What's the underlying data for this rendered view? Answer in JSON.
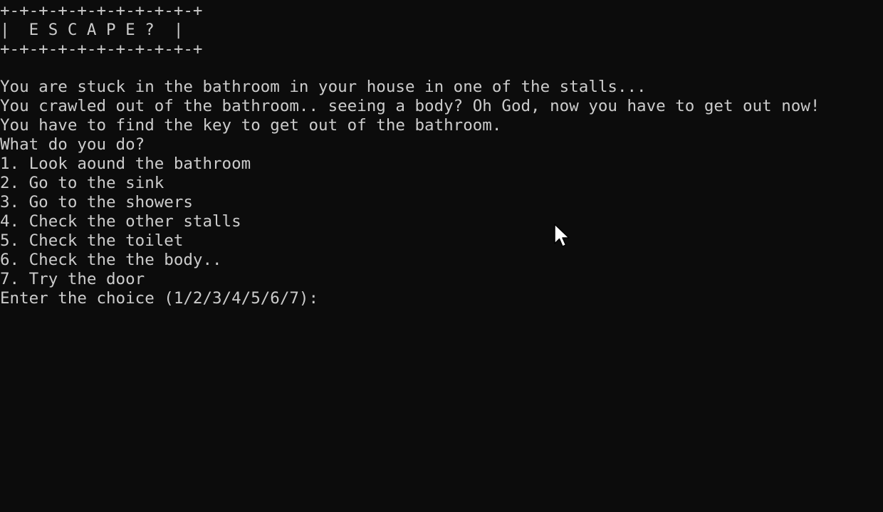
{
  "terminal": {
    "banner": {
      "border_top": "+-+-+-+-+-+-+-+-+-+-+",
      "title": "|  E S C A P E ?  |",
      "border_bottom": "+-+-+-+-+-+-+-+-+-+-+"
    },
    "story": [
      "You are stuck in the bathroom in your house in one of the stalls...",
      "You crawled out of the bathroom.. seeing a body? Oh God, now you have to get out now!",
      "You have to find the key to get out of the bathroom.",
      "What do you do?"
    ],
    "options": [
      "1. Look aound the bathroom",
      "2. Go to the sink",
      "3. Go to the showers",
      "4. Check the other stalls",
      "5. Check the toilet",
      "6. Check the the body..",
      "7. Try the door"
    ],
    "prompt": "Enter the choice (1/2/3/4/5/6/7):"
  },
  "mouse_cursor": {
    "icon": "arrow-pointer-icon"
  }
}
